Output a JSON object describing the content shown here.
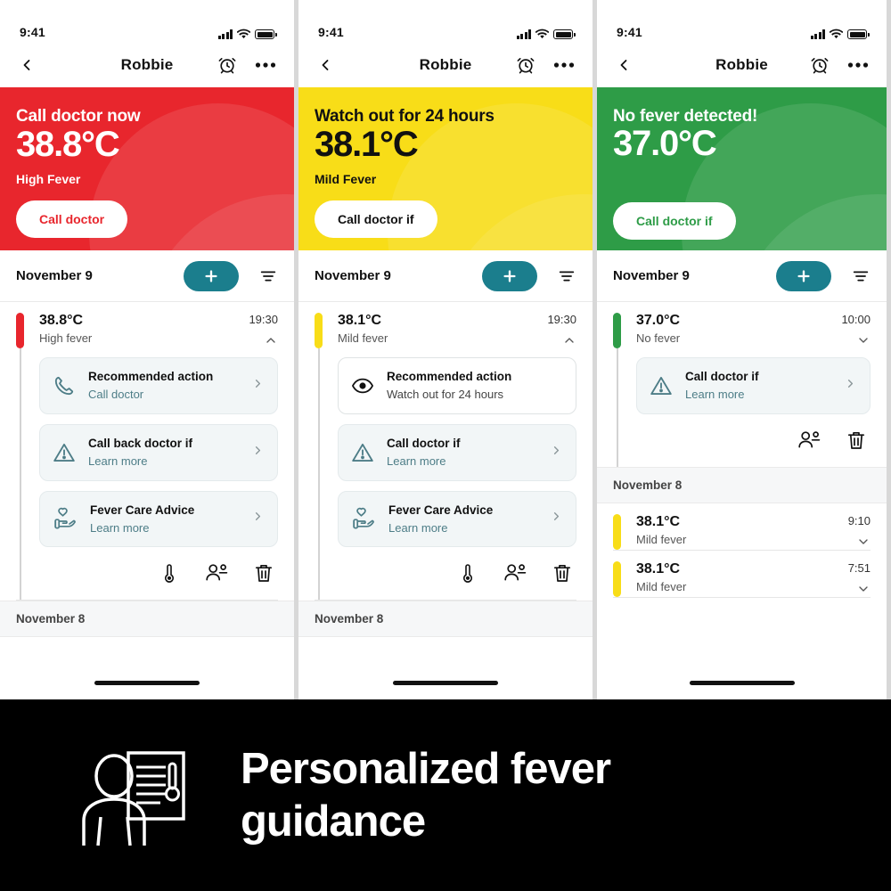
{
  "status_bar": {
    "time": "9:41",
    "signal_icon": "cellular-signal-icon",
    "wifi_icon": "wifi-icon",
    "battery_icon": "battery-icon"
  },
  "nav": {
    "back_icon": "chevron-left-icon",
    "title": "Robbie",
    "alarm_icon": "alarm-clock-icon",
    "more_icon": "more-options-icon"
  },
  "colors": {
    "red": "#E8262D",
    "yellow": "#F8DD18",
    "green": "#2E9C47",
    "teal": "#1B7E8D",
    "link": "#4D7D87"
  },
  "toolbar": {
    "date": "November 9",
    "add_icon": "plus-icon",
    "filter_icon": "filter-icon"
  },
  "divider_day": "November 8",
  "row_actions": {
    "thermometer_icon": "thermometer-icon",
    "share_icon": "share-user-icon",
    "delete_icon": "trash-icon"
  },
  "panels": [
    {
      "id": "high-fever",
      "hero": {
        "title": "Call doctor now",
        "temperature": "38.8°C",
        "subtitle": "High Fever",
        "button": "Call doctor",
        "theme": "red"
      },
      "reading": {
        "temperature": "38.8°C",
        "state": "High fever",
        "time": "19:30",
        "chevron": "chevron-up-icon",
        "bar": "red"
      },
      "cards": [
        {
          "icon": "phone-icon",
          "title": "Recommended action",
          "subtitle": "Call doctor",
          "chevron": "chevron-right-icon",
          "style": "tinted"
        },
        {
          "icon": "warning-triangle-icon",
          "title": "Call back doctor if",
          "subtitle": "Learn more",
          "chevron": "chevron-right-icon",
          "style": "tinted"
        },
        {
          "icon": "heart-hand-icon",
          "title": "Fever Care Advice",
          "subtitle": "Learn more",
          "chevron": "chevron-right-icon",
          "style": "tinted"
        }
      ],
      "actions": [
        "thermometer-icon",
        "share-user-icon",
        "trash-icon"
      ]
    },
    {
      "id": "mild-fever",
      "hero": {
        "title": "Watch out for 24 hours",
        "temperature": "38.1°C",
        "subtitle": "Mild Fever",
        "button": "Call doctor if",
        "theme": "yellow"
      },
      "reading": {
        "temperature": "38.1°C",
        "state": "Mild fever",
        "time": "19:30",
        "chevron": "chevron-up-icon",
        "bar": "yellow"
      },
      "cards": [
        {
          "icon": "eye-icon",
          "title": "Recommended action",
          "subtitle": "Watch out for 24 hours",
          "chevron": "",
          "style": "plain"
        },
        {
          "icon": "warning-triangle-icon",
          "title": "Call doctor if",
          "subtitle": "Learn more",
          "chevron": "chevron-right-icon",
          "style": "tinted"
        },
        {
          "icon": "heart-hand-icon",
          "title": "Fever Care Advice",
          "subtitle": "Learn more",
          "chevron": "chevron-right-icon",
          "style": "tinted"
        }
      ],
      "actions": [
        "thermometer-icon",
        "share-user-icon",
        "trash-icon"
      ]
    },
    {
      "id": "no-fever",
      "hero": {
        "title": "No fever detected!",
        "temperature": "37.0°C",
        "subtitle": "",
        "button": "Call doctor if",
        "theme": "green"
      },
      "reading": {
        "temperature": "37.0°C",
        "state": "No fever",
        "time": "10:00",
        "chevron": "chevron-down-icon",
        "bar": "green"
      },
      "cards": [
        {
          "icon": "warning-triangle-icon",
          "title": "Call doctor if",
          "subtitle": "Learn more",
          "chevron": "chevron-right-icon",
          "style": "tinted"
        }
      ],
      "actions": [
        "share-user-icon",
        "trash-icon"
      ],
      "previous_day": {
        "label": "November 8",
        "rows": [
          {
            "temperature": "38.1°C",
            "state": "Mild fever",
            "time": "9:10",
            "chevron": "chevron-down-icon",
            "bar": "yellow"
          },
          {
            "temperature": "38.1°C",
            "state": "Mild fever",
            "time": "7:51",
            "chevron": "chevron-down-icon",
            "bar": "yellow"
          }
        ]
      }
    }
  ],
  "promo": {
    "icon": "person-with-report-icon",
    "headline": "Personalized fever guidance"
  }
}
